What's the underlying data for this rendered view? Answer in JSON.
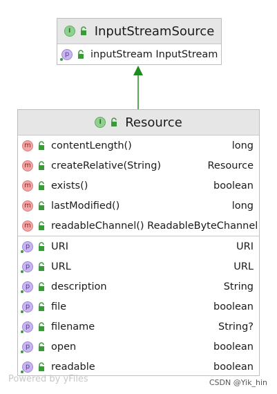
{
  "interface_top": {
    "name": "InputStreamSource",
    "kind_icon": "interface-icon",
    "members": [
      {
        "icon": "property-icon",
        "letter": "p",
        "name": "inputStream InputStream",
        "type": ""
      }
    ]
  },
  "interface_main": {
    "name": "Resource",
    "kind_icon": "interface-icon",
    "methods": [
      {
        "icon": "method-icon",
        "letter": "m",
        "name": "contentLength()",
        "type": "long"
      },
      {
        "icon": "method-icon",
        "letter": "m",
        "name": "createRelative(String)",
        "type": "Resource"
      },
      {
        "icon": "method-icon",
        "letter": "m",
        "name": "exists()",
        "type": "boolean"
      },
      {
        "icon": "method-icon",
        "letter": "m",
        "name": "lastModified()",
        "type": "long"
      },
      {
        "icon": "method-icon",
        "letter": "m",
        "name": "readableChannel() ReadableByteChannel",
        "type": ""
      }
    ],
    "properties": [
      {
        "icon": "property-icon",
        "letter": "p",
        "name": "URI",
        "type": "URI"
      },
      {
        "icon": "property-icon",
        "letter": "p",
        "name": "URL",
        "type": "URL"
      },
      {
        "icon": "property-icon",
        "letter": "p",
        "name": "description",
        "type": "String"
      },
      {
        "icon": "property-icon",
        "letter": "p",
        "name": "file",
        "type": "boolean"
      },
      {
        "icon": "property-icon",
        "letter": "p",
        "name": "filename",
        "type": "String?"
      },
      {
        "icon": "property-icon",
        "letter": "p",
        "name": "open",
        "type": "boolean"
      },
      {
        "icon": "property-icon",
        "letter": "p",
        "name": "readable",
        "type": "boolean"
      }
    ]
  },
  "relation": {
    "type": "extends",
    "color": "#1e8c1e"
  },
  "watermark_left": "Powered by yFiles",
  "watermark_right": "CSDN @Yik_hin"
}
